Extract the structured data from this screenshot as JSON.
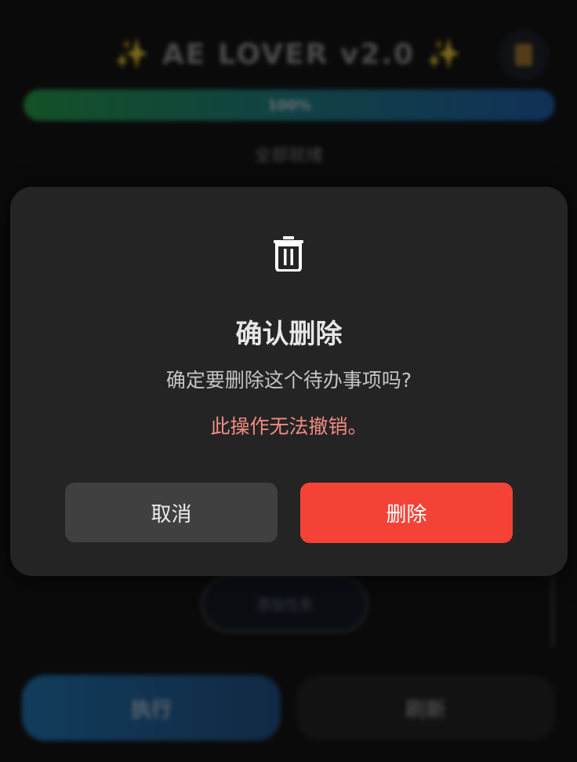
{
  "app": {
    "title": "AE LOVER v2.0",
    "sparkle_left": "✨",
    "sparkle_right": "✨",
    "menu_icon": "notepad-icon",
    "progress": {
      "label": "100%",
      "value_percent": 100
    },
    "status": "全部就绪",
    "add_task_label": "添加任务",
    "execute_label": "执行",
    "refresh_label": "刷新"
  },
  "dialog": {
    "icon": "trash-icon",
    "title": "确认删除",
    "message": "确定要删除这个待办事项吗?",
    "warning": "此操作无法撤销。",
    "cancel_label": "取消",
    "delete_label": "删除"
  },
  "colors": {
    "background": "#0a0a0a",
    "dialog_bg": "#242424",
    "cancel_bg": "#404040",
    "delete_bg": "#f44336",
    "warning_text": "#f28b82"
  }
}
